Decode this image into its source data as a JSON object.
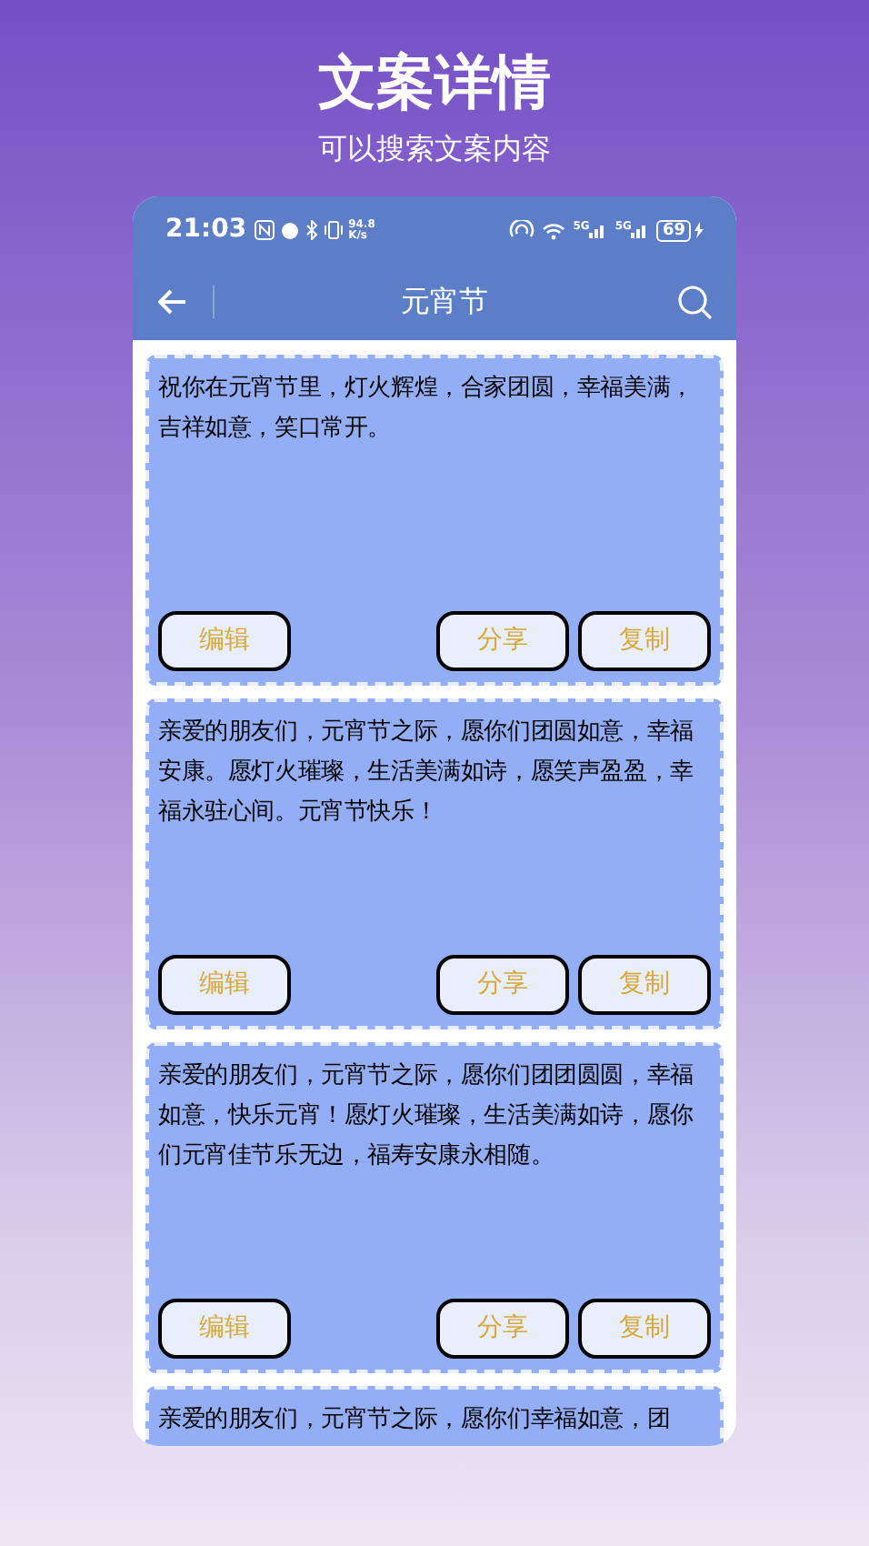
{
  "page": {
    "title": "文案详情",
    "subtitle": "可以搜索文案内容"
  },
  "status_bar": {
    "time": "21:03",
    "net_speed": "94.8 K/s",
    "signal_labels": [
      "5G",
      "5G"
    ],
    "battery": "69"
  },
  "header": {
    "title": "元宵节"
  },
  "cards": [
    {
      "text": "祝你在元宵节里，灯火辉煌，合家团圆，幸福美满，吉祥如意，笑口常开。",
      "buttons": [
        "编辑",
        "分享",
        "复制"
      ]
    },
    {
      "text": "亲爱的朋友们，元宵节之际，愿你们团圆如意，幸福安康。愿灯火璀璨，生活美满如诗，愿笑声盈盈，幸福永驻心间。元宵节快乐！",
      "buttons": [
        "编辑",
        "分享",
        "复制"
      ]
    },
    {
      "text": "亲爱的朋友们，元宵节之际，愿你们团团圆圆，幸福如意，快乐元宵！愿灯火璀璨，生活美满如诗，愿你们元宵佳节乐无边，福寿安康永相随。",
      "buttons": [
        "编辑",
        "分享",
        "复制"
      ]
    },
    {
      "text": "亲爱的朋友们，元宵节之际，愿你们幸福如意，团"
    }
  ]
}
